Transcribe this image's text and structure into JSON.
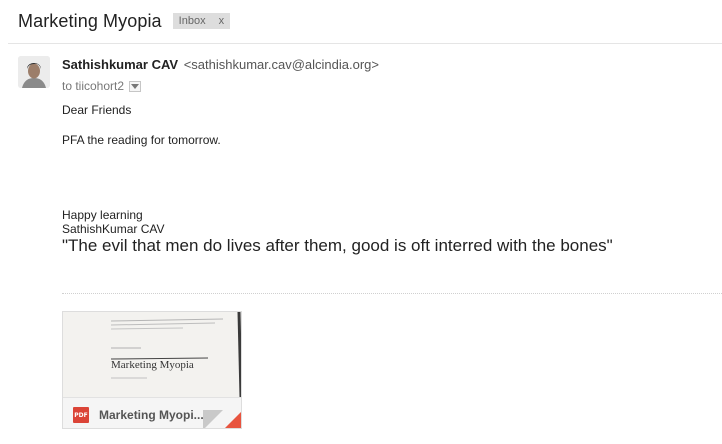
{
  "thread": {
    "subject": "Marketing Myopia",
    "label": "Inbox",
    "label_remove": "x"
  },
  "message": {
    "sender_name": "Sathishkumar CAV",
    "sender_email": "<sathishkumar.cav@alcindia.org>",
    "to_line": "to tiicohort2",
    "body": {
      "greeting": "Dear Friends",
      "line1": "PFA the reading for tomorrow.",
      "signature_line1": "Happy learning",
      "signature_line2": "SathishKumar CAV",
      "quote": "\"The evil that men do lives after them, good is oft interred with the bones\""
    }
  },
  "attachment": {
    "type_badge": "PDF",
    "filename": "Marketing Myopi...",
    "preview": {
      "title": "Marketing Myopia",
      "author": "by Theodore Levitt",
      "small_caps": "BEST OF HBR 1960"
    }
  },
  "colors": {
    "pdf_red": "#db4437",
    "corner_red": "#e8543f",
    "chip_bg": "#dddddd"
  }
}
